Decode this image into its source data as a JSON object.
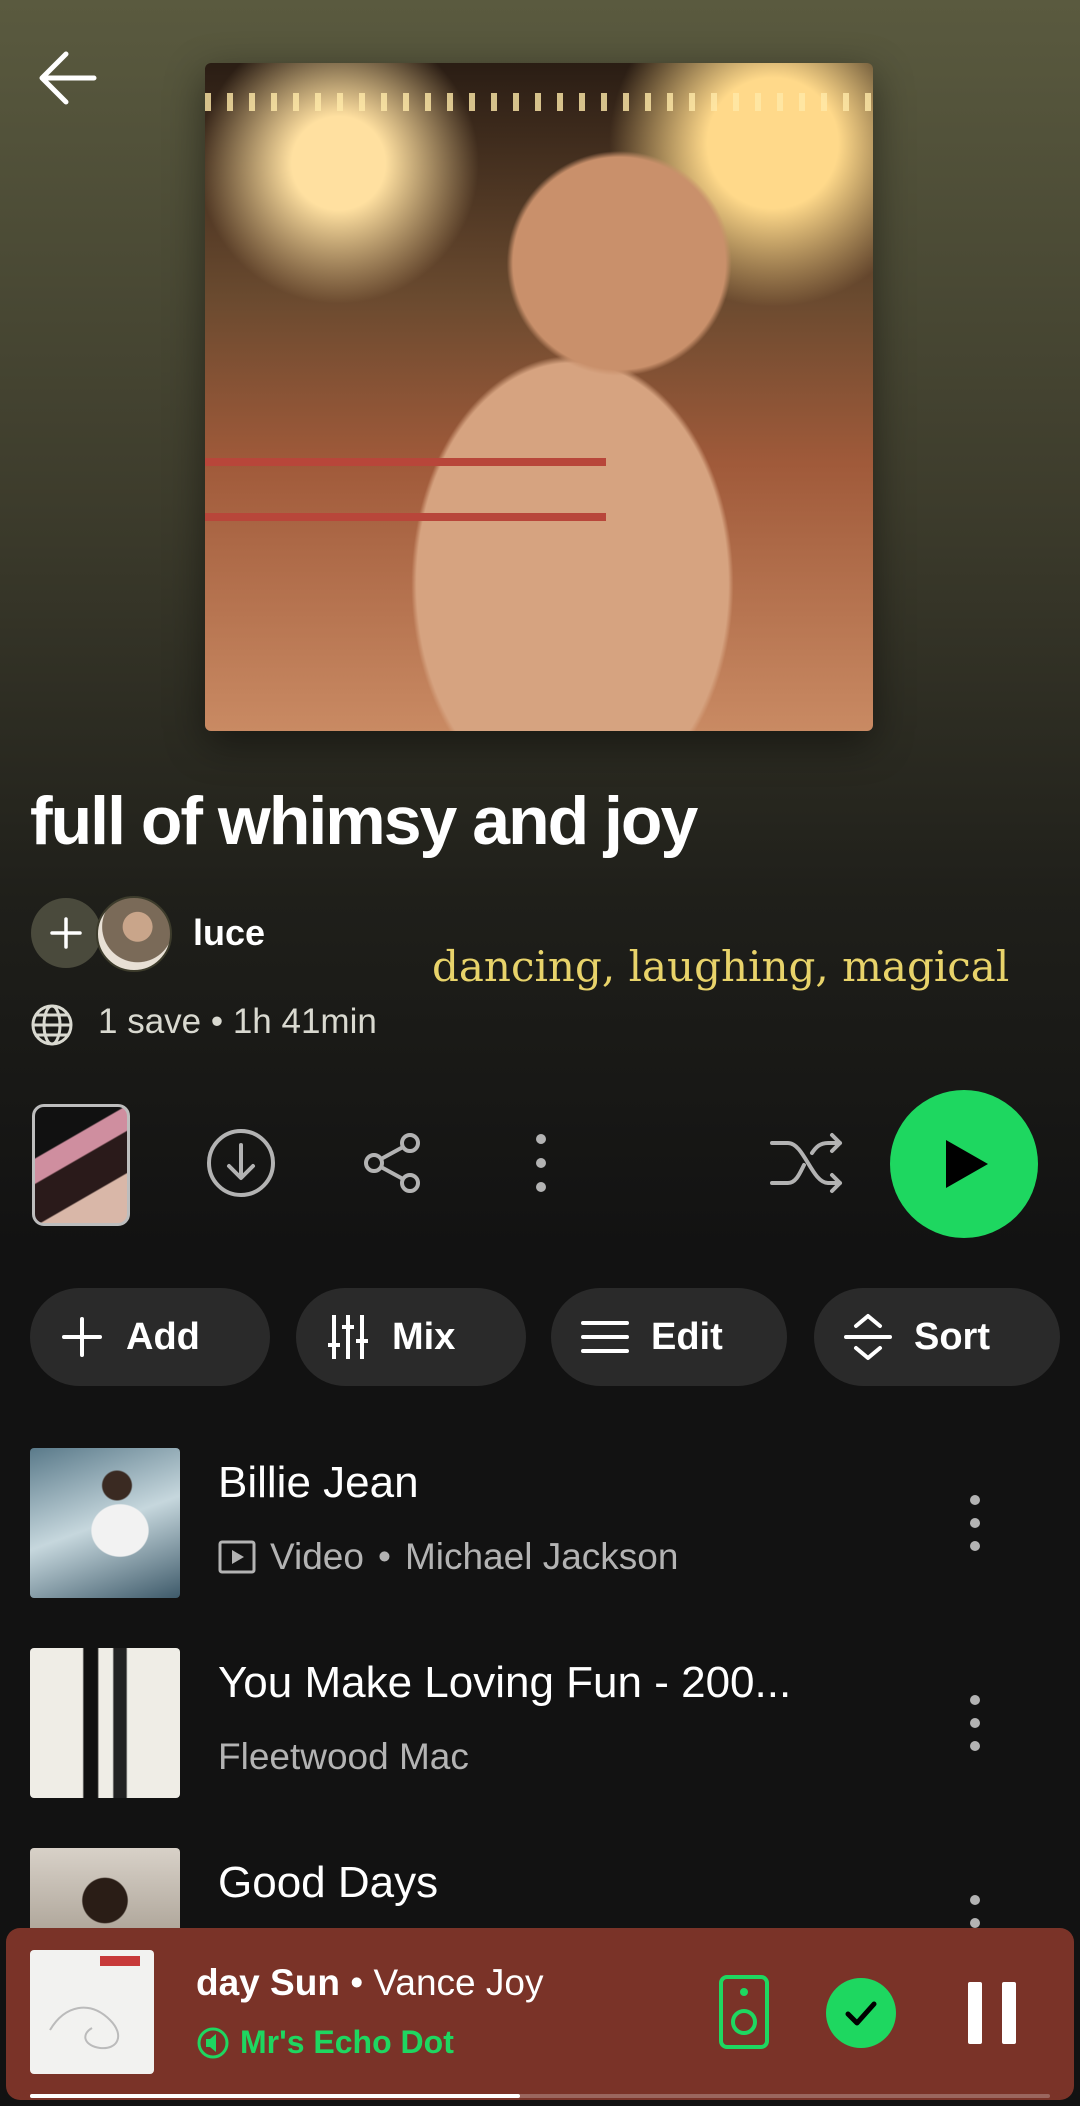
{
  "playlist": {
    "title": "full of whimsy and joy",
    "owner": "luce",
    "tagline": "dancing, laughing, magical",
    "meta": "1 save • 1h 41min"
  },
  "chips": [
    {
      "label": "Add",
      "icon": "plus-icon"
    },
    {
      "label": "Mix",
      "icon": "sliders-icon"
    },
    {
      "label": "Edit",
      "icon": "menu-icon"
    },
    {
      "label": "Sort",
      "icon": "sort-icon"
    }
  ],
  "tracks": [
    {
      "title": "Billie Jean",
      "type": "Video",
      "artist": "Michael Jackson"
    },
    {
      "title": "You Make Loving Fun - 200...",
      "artist": "Fleetwood Mac"
    },
    {
      "title": "Good Days"
    }
  ],
  "now_playing": {
    "title": "day Sun",
    "artist": "Vance Joy",
    "separator": " • ",
    "device": "Mr's Echo Dot",
    "progress": 0.48
  },
  "colors": {
    "accent": "#1ed760",
    "now_playing_bg": "#7a3328",
    "tagline": "#e8d36a"
  }
}
